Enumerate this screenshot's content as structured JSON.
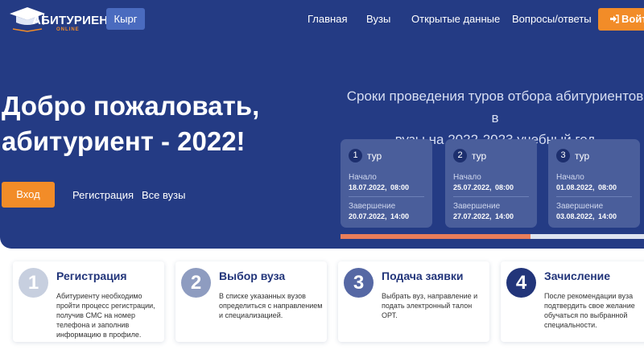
{
  "header": {
    "logo_title": "АБИТУРИЕНТ",
    "logo_subtitle": "ONLINE",
    "lang_button": "Кырг",
    "nav": [
      "Главная",
      "Вузы",
      "Открытые данные",
      "Вопросы/ответы"
    ],
    "login_button": "Войти"
  },
  "hero": {
    "title_line1": "Добро пожаловать,",
    "title_line2": "абитуриент - 2022!",
    "entry_button": "Вход",
    "registration_link": "Регистрация",
    "all_unis_link": "Все вузы"
  },
  "schedule": {
    "title_line1": "Сроки проведения туров отбора абитуриентов в",
    "title_line2": "вузы на 2022-2023 учебный год",
    "rounds": [
      {
        "num": "1",
        "label": "тур",
        "start_label": "Начало",
        "start": "18.07.2022, 08:00",
        "end_label": "Завершение",
        "end": "20.07.2022, 14:00"
      },
      {
        "num": "2",
        "label": "тур",
        "start_label": "Начало",
        "start": "25.07.2022, 08:00",
        "end_label": "Завершение",
        "end": "27.07.2022, 14:00"
      },
      {
        "num": "3",
        "label": "тур",
        "start_label": "Начало",
        "start": "01.08.2022, 08:00",
        "end_label": "Завершение",
        "end": "03.08.2022, 14:00"
      }
    ],
    "progress_fraction": 0.626
  },
  "steps": [
    {
      "num": "1",
      "title": "Регистрация",
      "desc": "Абитуриенту необходимо пройти процесс регистрации, получив СМС на номер телефона и заполнив информацию в профиле."
    },
    {
      "num": "2",
      "title": "Выбор вуза",
      "desc": "В списке указанных вузов определиться с направлением и специализацией."
    },
    {
      "num": "3",
      "title": "Подача заявки",
      "desc": "Выбрать вуз, направление и подать электронный талон ОРТ."
    },
    {
      "num": "4",
      "title": "Зачисление",
      "desc": "После рекомендации вуза подтвердить свое желание обучаться по выбранной специальности."
    }
  ],
  "colors": {
    "hero_bg": "#243b84",
    "accent_orange": "#f28c28",
    "lang_button": "#4a6bbf",
    "round_card": "#4a5e9b",
    "progress": "#e87d5a",
    "step_circles": [
      "#c7cfdf",
      "#8e9cc0",
      "#5668a4",
      "#22357a"
    ]
  },
  "icons": {
    "logo": "graduation-cap-icon",
    "login": "sign-in-icon"
  }
}
